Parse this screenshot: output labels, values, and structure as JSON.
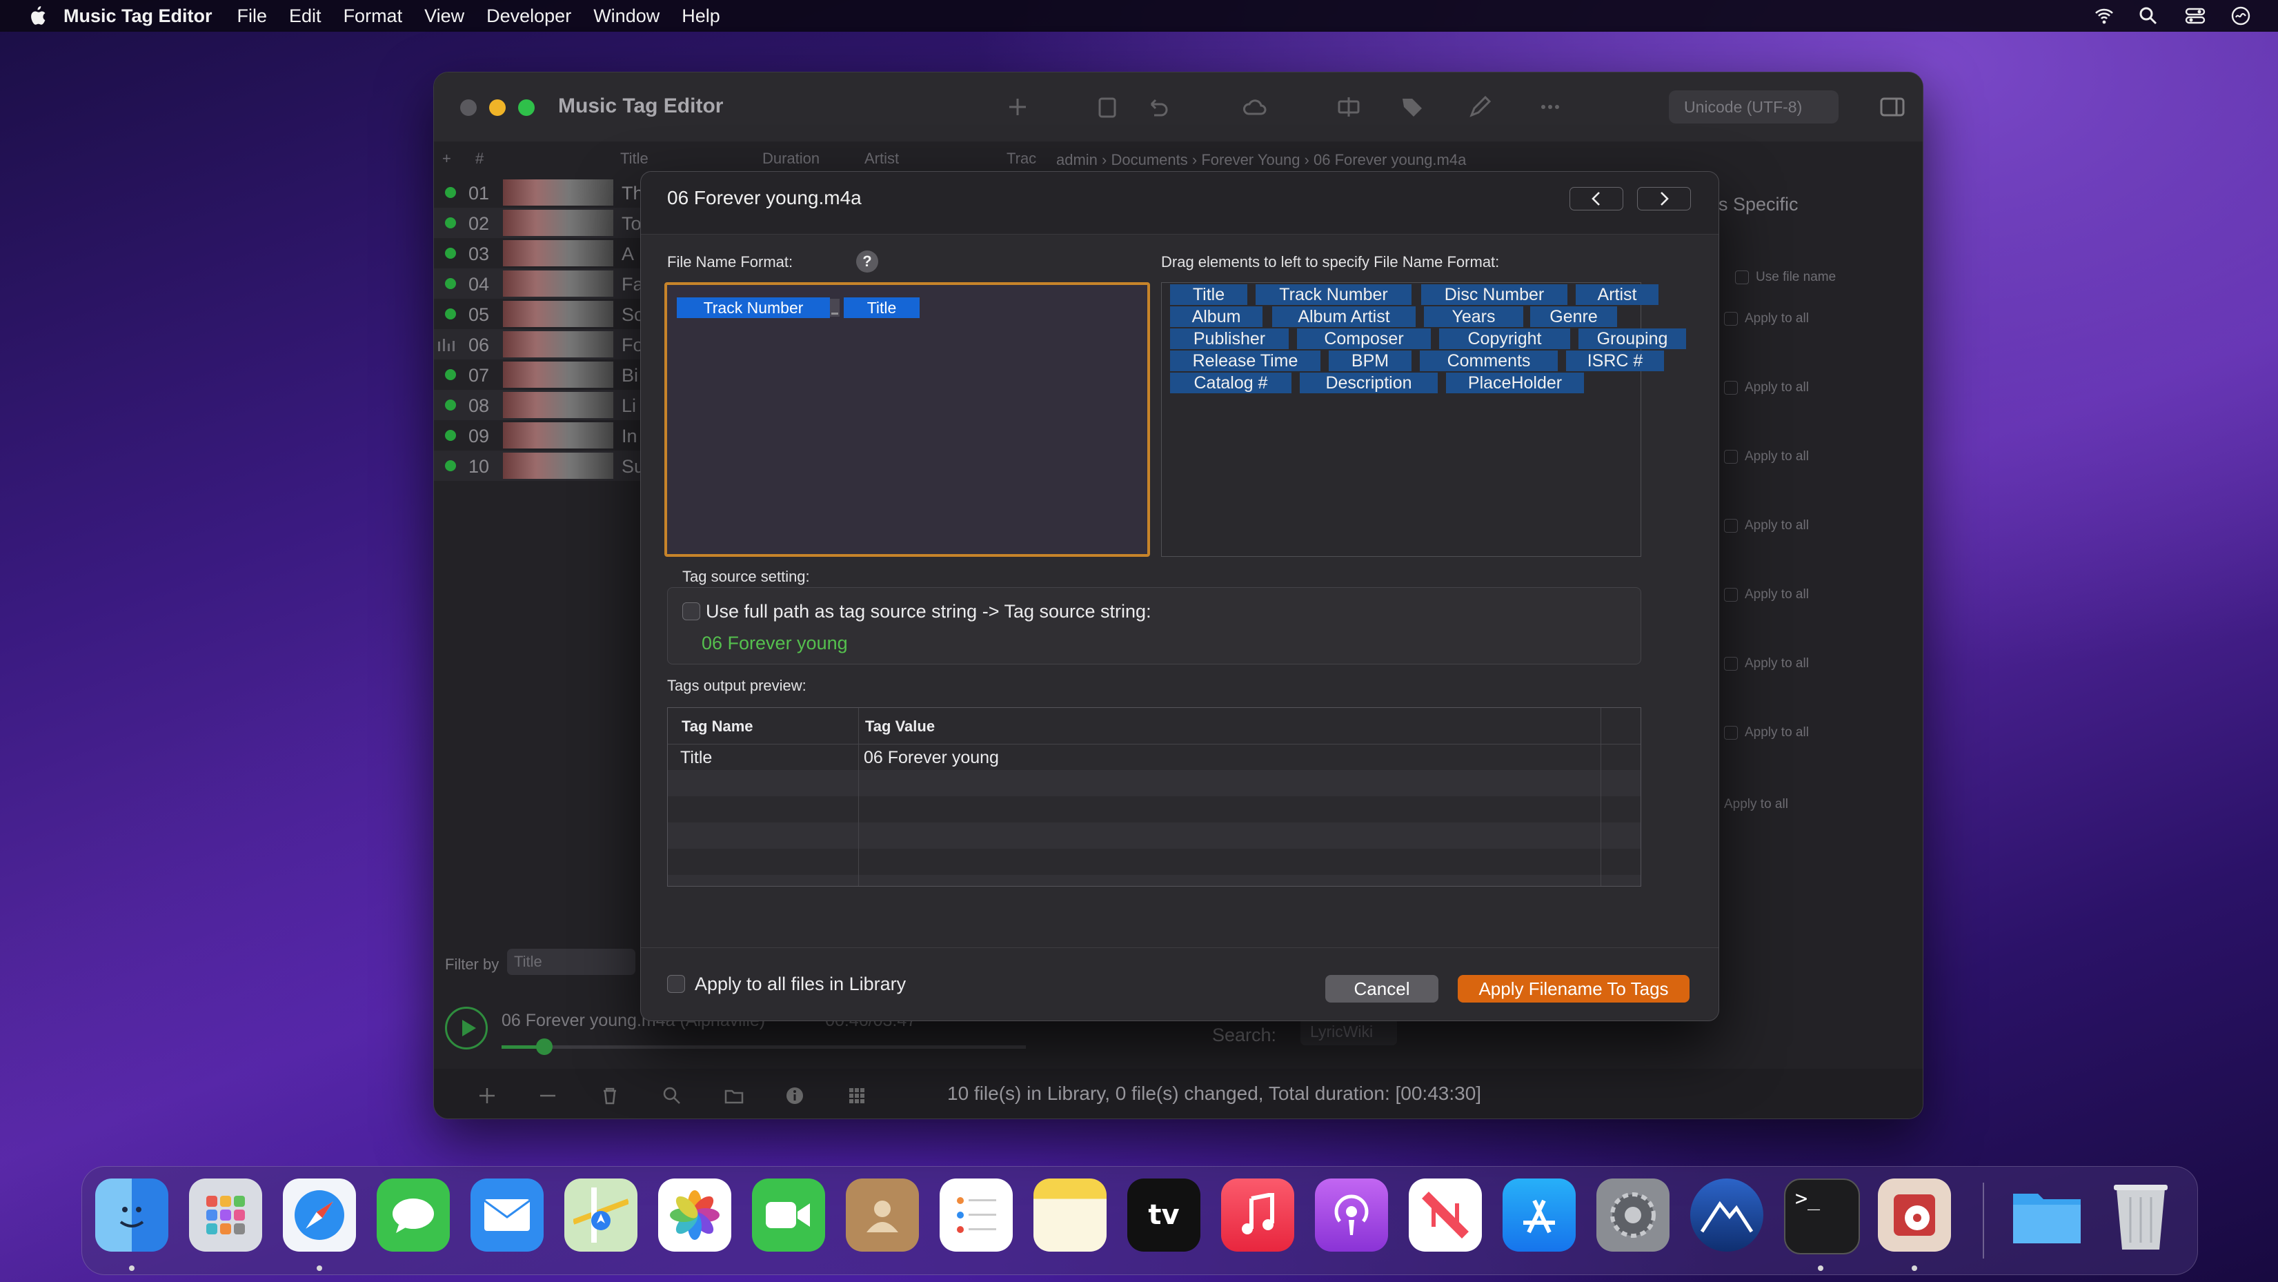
{
  "menubar": {
    "app": "Music Tag Editor",
    "items": [
      "File",
      "Edit",
      "Format",
      "View",
      "Developer",
      "Window",
      "Help"
    ]
  },
  "window": {
    "title": "Music Tag Editor",
    "encoding": "Unicode (UTF-8)",
    "table_headers": {
      "num": "#",
      "title": "Title",
      "duration": "Duration",
      "artist": "Artist",
      "track": "Trac"
    },
    "rows": [
      {
        "num": "01",
        "title": "Th"
      },
      {
        "num": "02",
        "title": "To"
      },
      {
        "num": "03",
        "title": "A"
      },
      {
        "num": "04",
        "title": "Fa"
      },
      {
        "num": "05",
        "title": "So"
      },
      {
        "num": "06",
        "title": "Fo"
      },
      {
        "num": "07",
        "title": "Bi"
      },
      {
        "num": "08",
        "title": "Li"
      },
      {
        "num": "09",
        "title": "In"
      },
      {
        "num": "10",
        "title": "Su"
      }
    ],
    "breadcrumb": [
      "admin",
      "Documents",
      "Forever Young",
      "06 Forever young.m4a"
    ],
    "right_panel": {
      "tab": "s Specific",
      "use_file_name": "Use file name",
      "apply_to_all": "Apply to all"
    },
    "filter_by": "Filter by",
    "filter_value": "Title",
    "now_playing": "06 Forever young.m4a (Alphaville)",
    "now_playing_time": "00:46/03:47",
    "search_label": "Search:",
    "lyric_source": "LyricWiki",
    "status": "10 file(s) in Library, 0 file(s) changed, Total duration: [00:43:30]"
  },
  "dialog": {
    "title": "06 Forever young.m4a",
    "file_name_format_label": "File Name Format:",
    "help": "?",
    "format_tokens": [
      "Track Number",
      "Title"
    ],
    "drag_label": "Drag elements to left to specify File Name Format:",
    "elements": [
      [
        "Title",
        "Track Number",
        "Disc Number",
        "Artist"
      ],
      [
        "Album",
        "Album Artist",
        "Years",
        "Genre"
      ],
      [
        "Publisher",
        "Composer",
        "Copyright",
        "Grouping"
      ],
      [
        "Release Time",
        "BPM",
        "Comments",
        "ISRC #"
      ],
      [
        "Catalog #",
        "Description",
        "PlaceHolder"
      ]
    ],
    "tag_source_label": "Tag source setting:",
    "use_full_path": "Use full path as tag source string -> Tag source string:",
    "tag_source_value": "06 Forever young",
    "preview_label": "Tags output preview:",
    "preview_headers": [
      "Tag Name",
      "Tag Value"
    ],
    "preview_rows": [
      [
        "Title",
        "06 Forever young"
      ]
    ],
    "apply_all_files": "Apply to all files in Library",
    "cancel": "Cancel",
    "apply": "Apply Filename To Tags"
  },
  "colors": {
    "accent_orange": "#d9650f",
    "token_blue": "#1566d6",
    "element_blue": "#1d4f8c",
    "source_green": "#55c04e",
    "focus_ring": "#c7842a"
  },
  "dock": [
    "Finder",
    "Launchpad",
    "Safari",
    "Messages",
    "Mail",
    "Maps",
    "Photos",
    "FaceTime",
    "Contacts",
    "Reminders",
    "Notes",
    "TV",
    "Music",
    "Podcasts",
    "News",
    "App Store",
    "System Preferences",
    "Monterey",
    "Terminal",
    "ID3 Editor",
    "Folder",
    "Trash"
  ]
}
